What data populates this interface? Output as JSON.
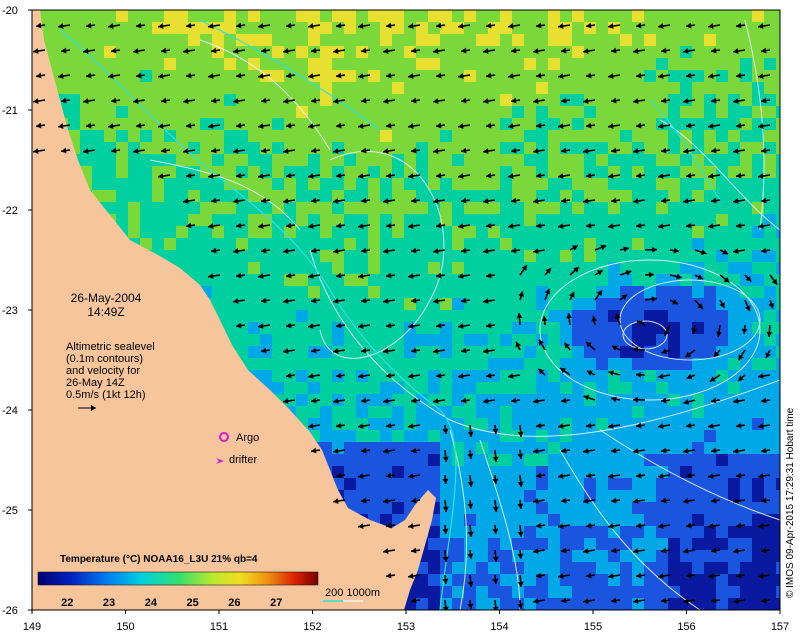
{
  "map": {
    "lon_range": [
      149,
      157
    ],
    "lat_range": [
      -26,
      -20
    ],
    "lon_ticks": [
      "149",
      "150",
      "151",
      "152",
      "153",
      "154",
      "155",
      "156",
      "157"
    ],
    "lat_ticks": [
      "-20",
      "-21",
      "-22",
      "-23",
      "-24",
      "-25",
      "-26"
    ],
    "land_color": "#f7c59b",
    "sea_palette": [
      "#0a1aa0",
      "#1a55e0",
      "#00a8e8",
      "#00d0a0",
      "#7ad83a",
      "#e8e030",
      "#f0a020"
    ]
  },
  "date": {
    "line1": "26-May-2004",
    "line2": "14:49Z"
  },
  "altimetry_note": [
    "Altimetric sealevel",
    "(0.1m contours)",
    "and velocity for",
    "26-May 14Z",
    "0.5m/s (1kt 12h)"
  ],
  "markers": {
    "argo_label": "Argo",
    "drifter_label": "drifter",
    "marker_color": "#d020d0"
  },
  "legend": {
    "title": "Temperature (°C) NOAA16_L3U 21% qb=4",
    "ticks": [
      "22",
      "23",
      "24",
      "25",
      "26",
      "27"
    ],
    "depth_label": "200  1000m"
  },
  "credit": "© IMOS 09-Apr-2015 17:29:31 Hobart time"
}
